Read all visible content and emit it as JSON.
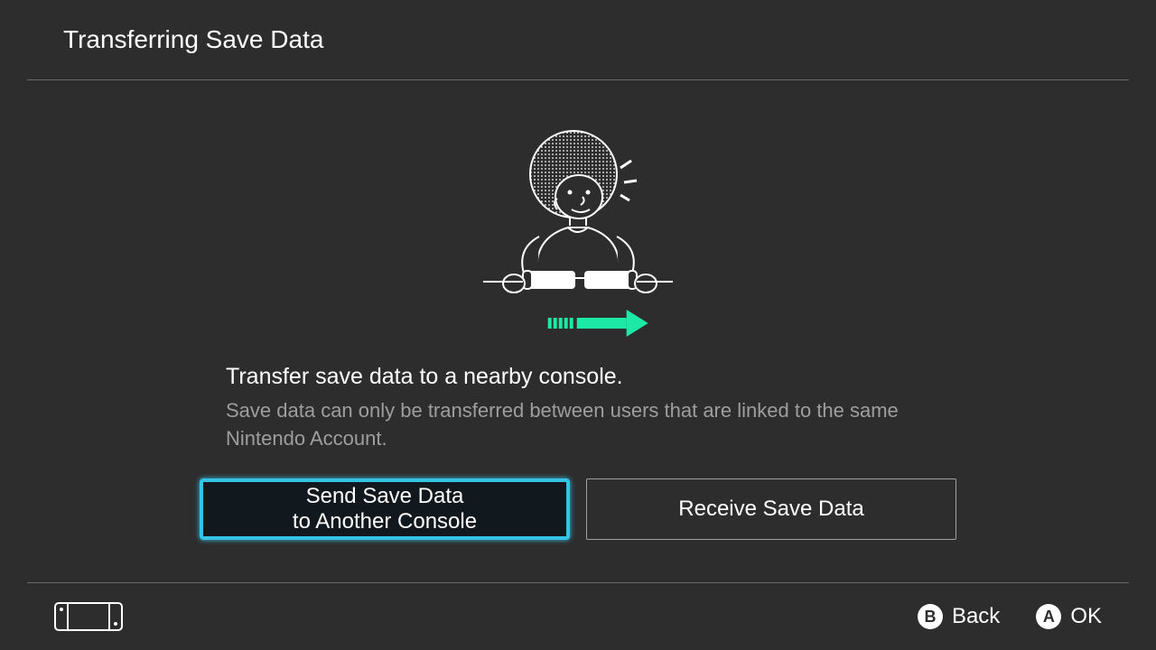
{
  "header": {
    "title": "Transferring Save Data"
  },
  "main": {
    "headline": "Transfer save data to a nearby console.",
    "subtext": "Save data can only be transferred between users that are linked to the same Nintendo Account."
  },
  "buttons": {
    "send": "Send Save Data\nto Another Console",
    "receive": "Receive Save Data"
  },
  "footer": {
    "back_key": "B",
    "back_label": "Back",
    "ok_key": "A",
    "ok_label": "OK"
  },
  "colors": {
    "accent": "#1ee8a5",
    "highlight": "#34c3e4"
  }
}
